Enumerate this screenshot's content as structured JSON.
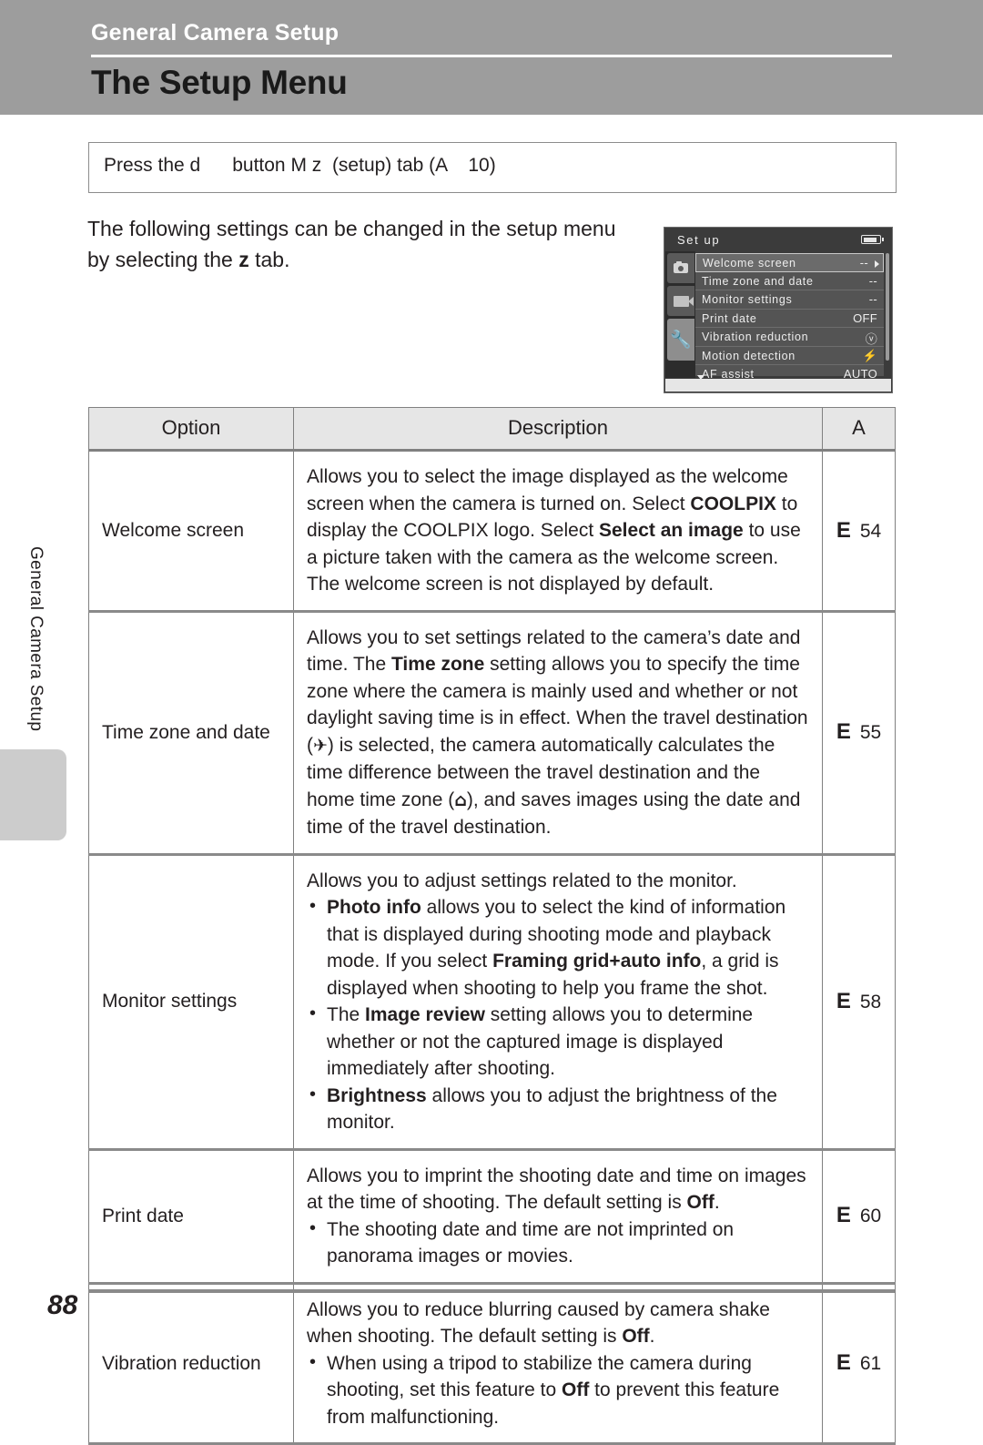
{
  "header": {
    "chapter": "General Camera Setup",
    "title": "The Setup Menu"
  },
  "sidebar": {
    "vertical_label": "General Camera Setup"
  },
  "press_box": {
    "text": "Press the d      button M z  (setup) tab (A    10)"
  },
  "intro": {
    "line1": "The following settings can be changed in the setup",
    "line2_before": "menu by selecting the ",
    "line2_symbol": "z",
    "line2_after": "  tab."
  },
  "lcd": {
    "title": "Set up",
    "battery_icon": "battery-icon",
    "tabs": [
      {
        "icon": "shooting-camera-icon"
      },
      {
        "icon": "movie-camera-icon"
      },
      {
        "icon": "wrench-setup-icon",
        "glyph": "⚙"
      }
    ],
    "rows": [
      {
        "label": "Welcome screen",
        "value": "--",
        "selected": true,
        "caret": true
      },
      {
        "label": "Time zone and date",
        "value": "--",
        "selected": false,
        "caret": false
      },
      {
        "label": "Monitor settings",
        "value": "--",
        "selected": false,
        "caret": false
      },
      {
        "label": "Print date",
        "value": "OFF",
        "selected": false,
        "caret": false
      },
      {
        "label": "Vibration reduction",
        "value": "ⓥ",
        "selected": false,
        "caret": false
      },
      {
        "label": "Motion detection",
        "value": "⚡",
        "selected": false,
        "caret": false
      },
      {
        "label": "AF assist",
        "value": "AUTO",
        "selected": false,
        "caret": false,
        "down": true
      }
    ]
  },
  "table": {
    "headers": {
      "option": "Option",
      "description": "Description",
      "reference": "A"
    },
    "rows": [
      {
        "option": "Welcome screen",
        "ref_symbol": "E",
        "ref_page": "54"
      },
      {
        "option": "Time zone and date",
        "ref_symbol": "E",
        "ref_page": "55"
      },
      {
        "option": "Monitor settings",
        "ref_symbol": "E",
        "ref_page": "58"
      },
      {
        "option": "Print date",
        "ref_symbol": "E",
        "ref_page": "60"
      },
      {
        "option": "Vibration reduction",
        "ref_symbol": "E",
        "ref_page": "61"
      }
    ],
    "descriptions": {
      "welcome_screen": {
        "p1_a": "Allows you to select the image displayed as the welcome screen when the camera is turned on. Select ",
        "b1": "COOLPIX",
        "p1_b": " to display the COOLPIX logo. Select ",
        "b2": "Select an image",
        "p1_c": " to use a picture taken with the camera as the welcome screen. The welcome screen is not displayed by default."
      },
      "time_zone_and_date": {
        "p1_a": "Allows you to set settings related to the camera’s date and time. The ",
        "b1": "Time zone",
        "p1_b": " setting allows you to specify the time zone where the camera is mainly used and whether or not daylight saving time is in effect. When the travel destination (",
        "g1": "✈",
        "p1_c": ") is selected, the camera automatically calculates the time difference between the travel destination and the home time zone (",
        "g2": "⌂",
        "p1_d": "), and saves images using the date and time of the travel destination."
      },
      "monitor_settings": {
        "lead": "Allows you to adjust settings related to the monitor.",
        "b1_a": "Photo info",
        "b1_b": " allows you to select the kind of information that is displayed during shooting mode and playback mode. If you select ",
        "b1_c": "Framing grid+auto info",
        "b1_d": ", a grid is displayed when shooting to help you frame the shot.",
        "b2_a": "The ",
        "b2_b": "Image review",
        "b2_c": " setting allows you to determine whether or not the captured image is displayed immediately after shooting.",
        "b3_a": "Brightness",
        "b3_b": " allows you to adjust the brightness of the monitor."
      },
      "print_date": {
        "p1_a": "Allows you to imprint the shooting date and time on images at the time of shooting. The default setting is ",
        "b1": "Off",
        "p1_b": ".",
        "b2": "The shooting date and time are not imprinted on panorama images or movies."
      },
      "vibration_reduction": {
        "p1_a": "Allows you to reduce blurring caused by camera shake when shooting. The default setting is ",
        "b1": "Off",
        "p1_b": ".",
        "b2_a": "When using a tripod to stabilize the camera during shooting, set this feature to ",
        "b2_b": "Off",
        "b2_c": " to prevent this feature from malfunctioning."
      }
    }
  },
  "footer": {
    "page_number": "88"
  }
}
